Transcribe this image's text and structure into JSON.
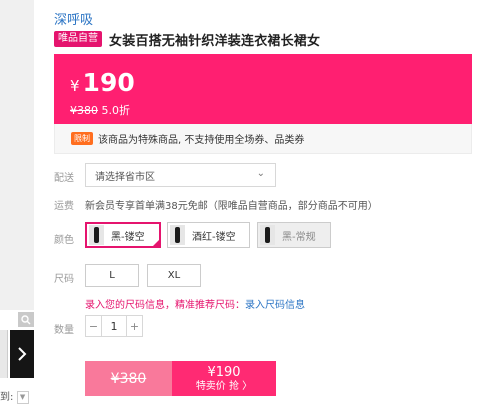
{
  "gallery": {
    "zoom_icon": "magnifier-icon",
    "next_icon": "chevron-right-icon",
    "goto_label": "到:",
    "goto_dropdown_icon": "triangle-down-icon"
  },
  "product": {
    "brand": "深呼吸",
    "badge": "唯品自营",
    "title": "女装百搭无袖针织洋装连衣裙长裙女"
  },
  "price": {
    "currency": "¥",
    "current": "190",
    "original": "¥380",
    "discount": "5.0折"
  },
  "notice": {
    "tag": "限制",
    "text": "该商品为特殊商品, 不支持使用全场券、品类券"
  },
  "delivery": {
    "label": "配送",
    "placeholder": "请选择省市区",
    "arrow_icon": "chevron-down-icon"
  },
  "shipping": {
    "label": "运费",
    "text": "新会员专享首单满38元免邮（限唯品自营商品，部分商品不可用）"
  },
  "colors": {
    "label": "颜色",
    "options": [
      {
        "name": "黑-镂空",
        "state": "selected"
      },
      {
        "name": "酒红-镂空",
        "state": "available"
      },
      {
        "name": "黑-常规",
        "state": "unavailable"
      }
    ]
  },
  "sizes": {
    "label": "尺码",
    "options": [
      "L",
      "XL"
    ],
    "hint": "录入您的尺码信息，精准推荐尺码：",
    "hint_link": "录入尺码信息"
  },
  "quantity": {
    "label": "数量",
    "minus": "−",
    "value": "1",
    "plus": "+"
  },
  "buy": {
    "original": "¥380",
    "price": "¥190",
    "cta": "特卖价 抢 〉"
  },
  "colors_theme": {
    "accent": "#ff1f71",
    "brand_link": "#2b74c4",
    "badge": "#e5146e"
  }
}
